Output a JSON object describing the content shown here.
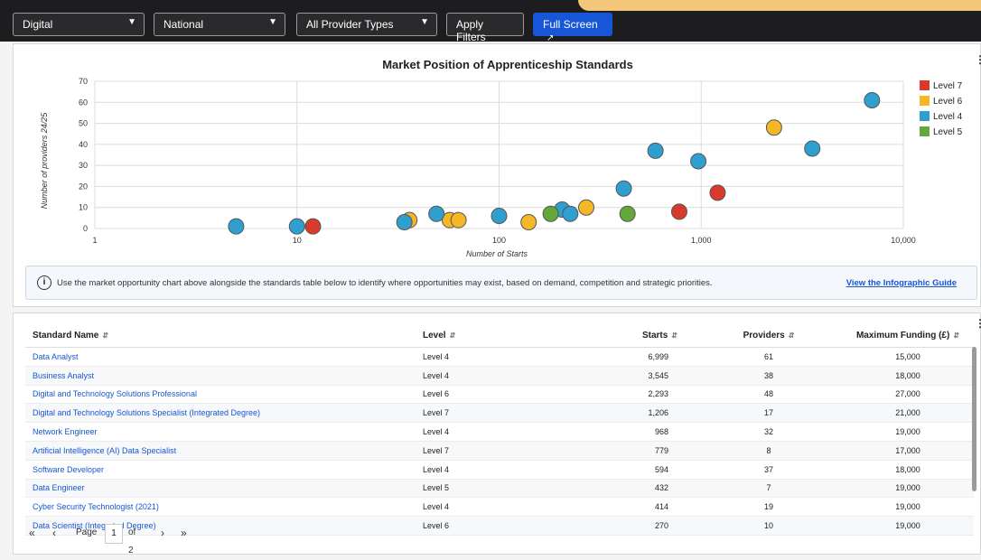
{
  "filters": {
    "field1": "Digital",
    "field2": "National",
    "field3": "All Provider Types",
    "apply_label": "Apply Filters",
    "fullscreen_label": "Full Screen"
  },
  "chart_data": {
    "type": "scatter",
    "title": "Market Position of Apprenticeship Standards",
    "xlabel": "Number of Starts",
    "ylabel": "Number of providers 24/25",
    "x_scale": "log",
    "xlim": [
      1,
      10000
    ],
    "ylim": [
      0,
      70
    ],
    "x_ticks": [
      "1",
      "10",
      "100",
      "1,000",
      "10,000"
    ],
    "y_ticks": [
      "0",
      "10",
      "20",
      "30",
      "40",
      "50",
      "60",
      "70"
    ],
    "grid": true,
    "legend_position": "right",
    "series": [
      {
        "name": "Level 7",
        "color": "#d93a2b",
        "points": [
          [
            12,
            1
          ],
          [
            779,
            8
          ],
          [
            1206,
            17
          ]
        ]
      },
      {
        "name": "Level 6",
        "color": "#f5b726",
        "points": [
          [
            36,
            4
          ],
          [
            57,
            4
          ],
          [
            63,
            4
          ],
          [
            140,
            3
          ],
          [
            270,
            10
          ],
          [
            2293,
            48
          ]
        ]
      },
      {
        "name": "Level 4",
        "color": "#2f9fd0",
        "points": [
          [
            5,
            1
          ],
          [
            10,
            1
          ],
          [
            34,
            3
          ],
          [
            49,
            7
          ],
          [
            100,
            6
          ],
          [
            205,
            9
          ],
          [
            225,
            7
          ],
          [
            414,
            19
          ],
          [
            594,
            37
          ],
          [
            968,
            32
          ],
          [
            3545,
            38
          ],
          [
            6999,
            61
          ]
        ]
      },
      {
        "name": "Level 5",
        "color": "#63a83a",
        "points": [
          [
            180,
            7
          ],
          [
            432,
            7
          ]
        ]
      }
    ]
  },
  "info": {
    "text": "Use the market opportunity chart above alongside the standards table below to identify where opportunities may exist, based on demand, competition and strategic priorities.",
    "link": "View the Infographic Guide"
  },
  "table": {
    "headers": [
      "Standard Name",
      "Level",
      "Starts",
      "Providers",
      "Maximum Funding (£)"
    ],
    "rows": [
      [
        "Data Analyst",
        "Level 4",
        "6,999",
        "61",
        "15,000"
      ],
      [
        "Business Analyst",
        "Level 4",
        "3,545",
        "38",
        "18,000"
      ],
      [
        "Digital and Technology Solutions Professional",
        "Level 6",
        "2,293",
        "48",
        "27,000"
      ],
      [
        "Digital and Technology Solutions Specialist (Integrated Degree)",
        "Level 7",
        "1,206",
        "17",
        "21,000"
      ],
      [
        "Network Engineer",
        "Level 4",
        "968",
        "32",
        "19,000"
      ],
      [
        "Artificial Intelligence (AI) Data Specialist",
        "Level 7",
        "779",
        "8",
        "17,000"
      ],
      [
        "Software Developer",
        "Level 4",
        "594",
        "37",
        "18,000"
      ],
      [
        "Data Engineer",
        "Level 5",
        "432",
        "7",
        "19,000"
      ],
      [
        "Cyber Security Technologist (2021)",
        "Level 4",
        "414",
        "19",
        "19,000"
      ],
      [
        "Data Scientist (Integrated Degree)",
        "Level 6",
        "270",
        "10",
        "19,000"
      ]
    ]
  },
  "pager": {
    "page_label": "Page",
    "page_value": "1",
    "of_label": "of 2"
  }
}
